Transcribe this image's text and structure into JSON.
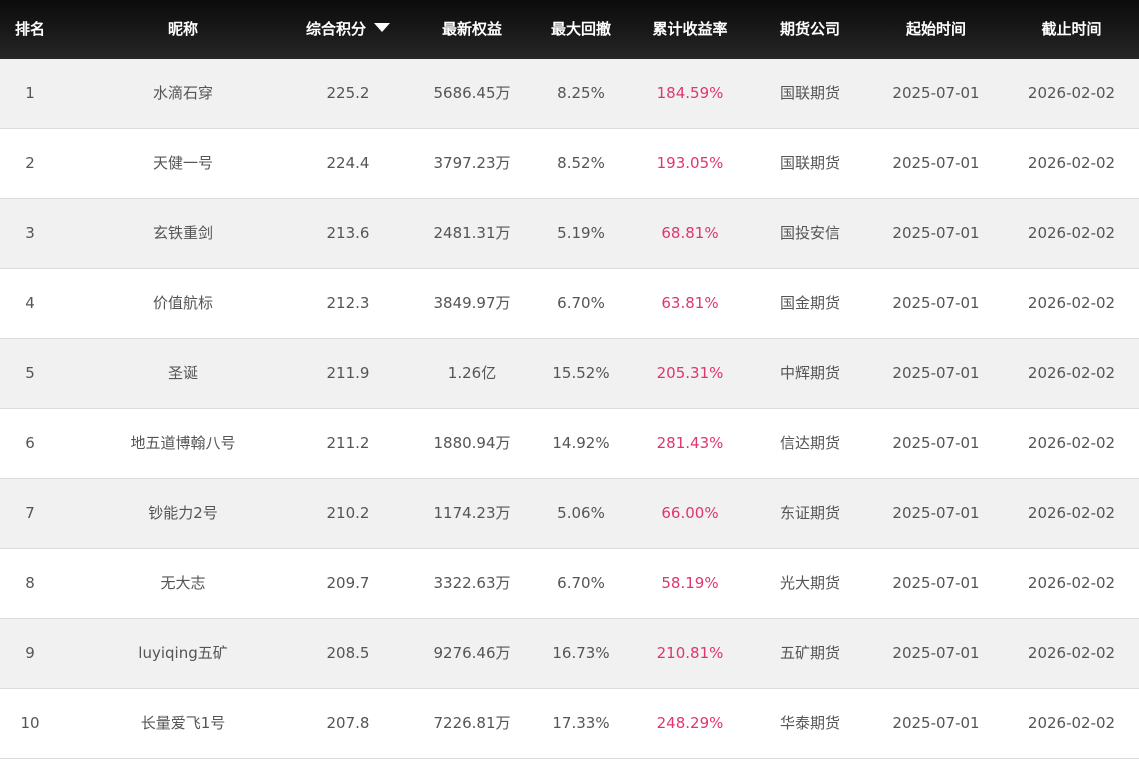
{
  "header": {
    "rank": "排名",
    "nickname": "昵称",
    "score": "综合积分",
    "equity": "最新权益",
    "drawdown": "最大回撤",
    "return_rate": "累计收益率",
    "company": "期货公司",
    "start": "起始时间",
    "end": "截止时间"
  },
  "sort_icon": "caret-down-icon",
  "colors": {
    "header_bg": "#141414",
    "return_color": "#e0356f",
    "row_alt": "#f1f1f1"
  },
  "rows": [
    {
      "rank": "1",
      "nickname": "水滴石穿",
      "score": "225.2",
      "equity": "5686.45万",
      "drawdown": "8.25%",
      "return_rate": "184.59%",
      "company": "国联期货",
      "start": "2025-07-01",
      "end": "2026-02-02"
    },
    {
      "rank": "2",
      "nickname": "天健一号",
      "score": "224.4",
      "equity": "3797.23万",
      "drawdown": "8.52%",
      "return_rate": "193.05%",
      "company": "国联期货",
      "start": "2025-07-01",
      "end": "2026-02-02"
    },
    {
      "rank": "3",
      "nickname": "玄铁重剑",
      "score": "213.6",
      "equity": "2481.31万",
      "drawdown": "5.19%",
      "return_rate": "68.81%",
      "company": "国投安信",
      "start": "2025-07-01",
      "end": "2026-02-02"
    },
    {
      "rank": "4",
      "nickname": "价值航标",
      "score": "212.3",
      "equity": "3849.97万",
      "drawdown": "6.70%",
      "return_rate": "63.81%",
      "company": "国金期货",
      "start": "2025-07-01",
      "end": "2026-02-02"
    },
    {
      "rank": "5",
      "nickname": "圣诞",
      "score": "211.9",
      "equity": "1.26亿",
      "drawdown": "15.52%",
      "return_rate": "205.31%",
      "company": "中辉期货",
      "start": "2025-07-01",
      "end": "2026-02-02"
    },
    {
      "rank": "6",
      "nickname": "地五道博翰八号",
      "score": "211.2",
      "equity": "1880.94万",
      "drawdown": "14.92%",
      "return_rate": "281.43%",
      "company": "信达期货",
      "start": "2025-07-01",
      "end": "2026-02-02"
    },
    {
      "rank": "7",
      "nickname": "钞能力2号",
      "score": "210.2",
      "equity": "1174.23万",
      "drawdown": "5.06%",
      "return_rate": "66.00%",
      "company": "东证期货",
      "start": "2025-07-01",
      "end": "2026-02-02"
    },
    {
      "rank": "8",
      "nickname": "无大志",
      "score": "209.7",
      "equity": "3322.63万",
      "drawdown": "6.70%",
      "return_rate": "58.19%",
      "company": "光大期货",
      "start": "2025-07-01",
      "end": "2026-02-02"
    },
    {
      "rank": "9",
      "nickname": "luyiqing五矿",
      "score": "208.5",
      "equity": "9276.46万",
      "drawdown": "16.73%",
      "return_rate": "210.81%",
      "company": "五矿期货",
      "start": "2025-07-01",
      "end": "2026-02-02"
    },
    {
      "rank": "10",
      "nickname": "长量爱飞1号",
      "score": "207.8",
      "equity": "7226.81万",
      "drawdown": "17.33%",
      "return_rate": "248.29%",
      "company": "华泰期货",
      "start": "2025-07-01",
      "end": "2026-02-02"
    }
  ]
}
